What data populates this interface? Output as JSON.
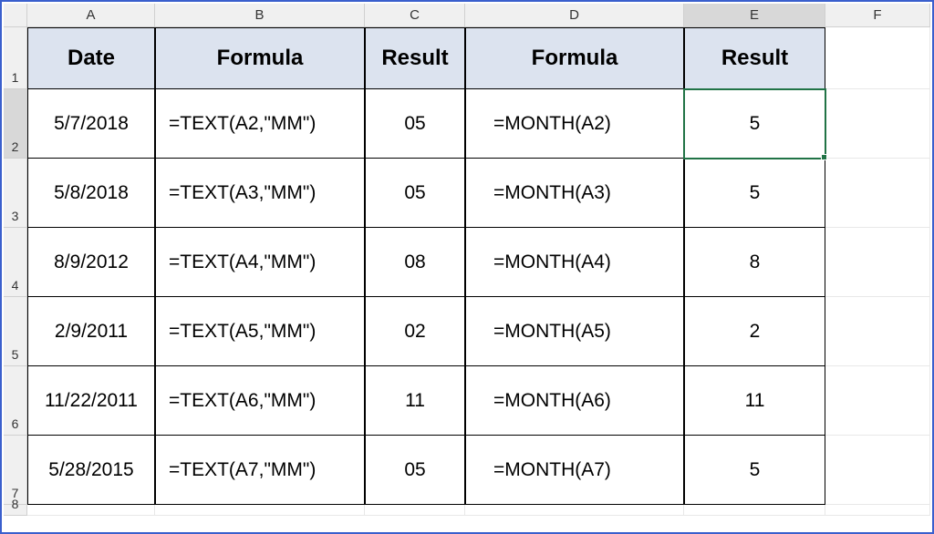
{
  "columns": [
    "A",
    "B",
    "C",
    "D",
    "E",
    "F"
  ],
  "selected_column": "E",
  "selected_row": "2",
  "row_labels": [
    "1",
    "2",
    "3",
    "4",
    "5",
    "6",
    "7",
    "8"
  ],
  "headers": {
    "A": "Date",
    "B": "Formula",
    "C": "Result",
    "D": "Formula",
    "E": "Result"
  },
  "rows": [
    {
      "A": "5/7/2018",
      "B": "=TEXT(A2,\"MM\")",
      "C": "05",
      "D": "=MONTH(A2)",
      "E": "5"
    },
    {
      "A": "5/8/2018",
      "B": "=TEXT(A3,\"MM\")",
      "C": "05",
      "D": "=MONTH(A3)",
      "E": "5"
    },
    {
      "A": "8/9/2012",
      "B": "=TEXT(A4,\"MM\")",
      "C": "08",
      "D": "=MONTH(A4)",
      "E": "8"
    },
    {
      "A": "2/9/2011",
      "B": "=TEXT(A5,\"MM\")",
      "C": "02",
      "D": "=MONTH(A5)",
      "E": "2"
    },
    {
      "A": "11/22/2011",
      "B": "=TEXT(A6,\"MM\")",
      "C": "11",
      "D": "=MONTH(A6)",
      "E": "11"
    },
    {
      "A": "5/28/2015",
      "B": "=TEXT(A7,\"MM\")",
      "C": "05",
      "D": "=MONTH(A7)",
      "E": "5"
    }
  ],
  "chart_data": {
    "type": "table",
    "headers": [
      "Date",
      "Formula",
      "Result",
      "Formula",
      "Result"
    ],
    "rows": [
      [
        "5/7/2018",
        "=TEXT(A2,\"MM\")",
        "05",
        "=MONTH(A2)",
        "5"
      ],
      [
        "5/8/2018",
        "=TEXT(A3,\"MM\")",
        "05",
        "=MONTH(A3)",
        "5"
      ],
      [
        "8/9/2012",
        "=TEXT(A4,\"MM\")",
        "08",
        "=MONTH(A4)",
        "8"
      ],
      [
        "2/9/2011",
        "=TEXT(A5,\"MM\")",
        "02",
        "=MONTH(A5)",
        "2"
      ],
      [
        "11/22/2011",
        "=TEXT(A6,\"MM\")",
        "11",
        "=MONTH(A6)",
        "11"
      ],
      [
        "5/28/2015",
        "=TEXT(A7,\"MM\")",
        "05",
        "=MONTH(A7)",
        "5"
      ]
    ]
  }
}
